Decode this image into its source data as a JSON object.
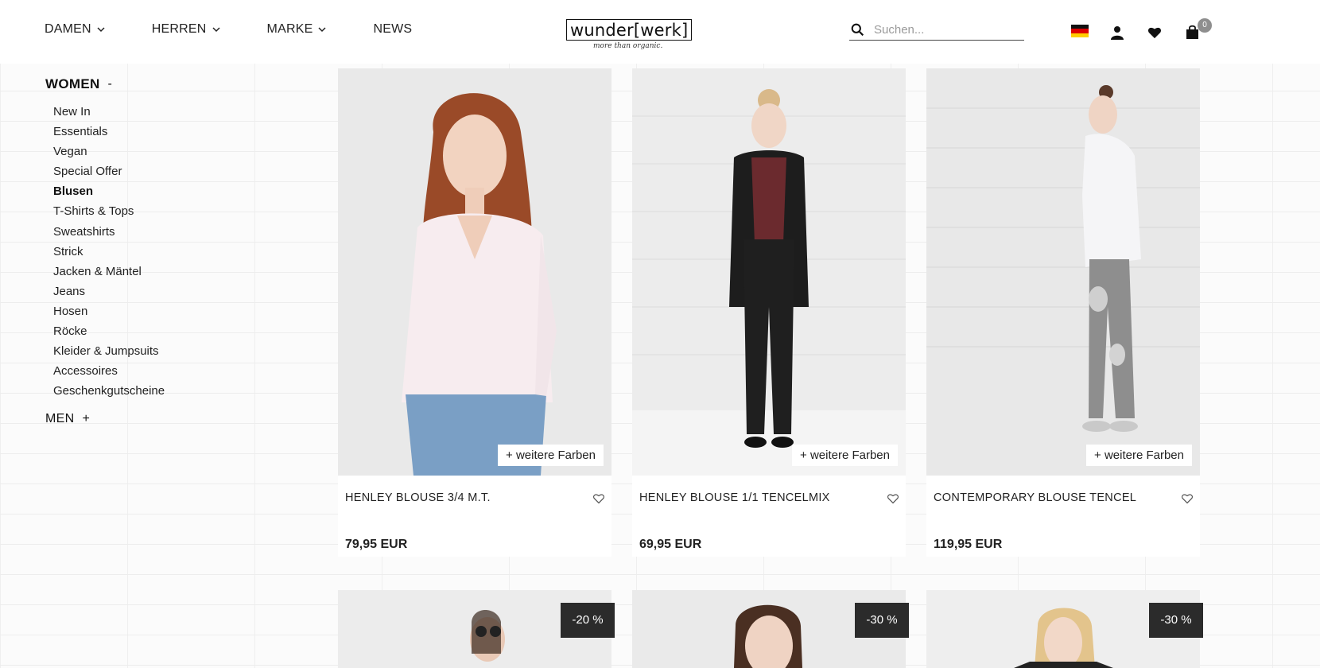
{
  "nav": {
    "items": [
      {
        "label": "DAMEN",
        "has_dropdown": true
      },
      {
        "label": "HERREN",
        "has_dropdown": true
      },
      {
        "label": "MARKE",
        "has_dropdown": true
      },
      {
        "label": "NEWS",
        "has_dropdown": false
      }
    ]
  },
  "logo": {
    "text": "wunder[werk]",
    "tagline": "more than organic."
  },
  "search": {
    "placeholder": "Suchen..."
  },
  "header_icons": {
    "flag": "german-flag-icon",
    "account": "user-icon",
    "wishlist": "heart-icon",
    "cart": "shopping-bag-icon",
    "cart_count": "0"
  },
  "sidebar": {
    "women": {
      "label": "WOMEN",
      "toggle": "-"
    },
    "items": [
      {
        "label": "New In",
        "active": false
      },
      {
        "label": "Essentials",
        "active": false
      },
      {
        "label": "Vegan",
        "active": false
      },
      {
        "label": "Special Offer",
        "active": false
      },
      {
        "label": "Blusen",
        "active": true
      },
      {
        "label": "T-Shirts & Tops",
        "active": false
      },
      {
        "label": "Sweatshirts",
        "active": false
      },
      {
        "label": "Strick",
        "active": false
      },
      {
        "label": "Jacken & Mäntel",
        "active": false
      },
      {
        "label": "Jeans",
        "active": false
      },
      {
        "label": "Hosen",
        "active": false
      },
      {
        "label": "Röcke",
        "active": false
      },
      {
        "label": "Kleider & Jumpsuits",
        "active": false
      },
      {
        "label": "Accessoires",
        "active": false
      },
      {
        "label": "Geschenkgutscheine",
        "active": false
      }
    ],
    "men": {
      "label": "MEN",
      "toggle": "+"
    }
  },
  "products": [
    {
      "name": "HENLEY BLOUSE 3/4 M.T.",
      "price": "79,95 EUR",
      "more_colors": "+ weitere Farben"
    },
    {
      "name": "HENLEY BLOUSE 1/1 TENCELMIX",
      "price": "69,95 EUR",
      "more_colors": "+ weitere Farben"
    },
    {
      "name": "CONTEMPORARY BLOUSE TENCEL",
      "price": "119,95 EUR",
      "more_colors": "+ weitere Farben"
    }
  ],
  "products_row2": [
    {
      "badge": "-20 %"
    },
    {
      "badge": "-30 %"
    },
    {
      "badge": "-30 %"
    }
  ]
}
